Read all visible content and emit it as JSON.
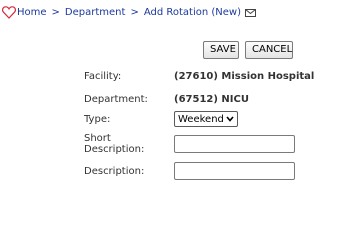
{
  "breadcrumb": {
    "items": [
      "Home",
      "Department",
      "Add Rotation (New)"
    ],
    "separator": ">"
  },
  "toolbar": {
    "save_label": "SAVE",
    "cancel_label": "CANCEL"
  },
  "form": {
    "facility": {
      "label": "Facility:",
      "value": "(27610) Mission Hospital"
    },
    "department": {
      "label": "Department:",
      "value": "(67512) NICU"
    },
    "type": {
      "label": "Type:",
      "selected": "Weekend"
    },
    "short_description": {
      "label": "Short Description:",
      "value": "",
      "placeholder": ""
    },
    "description": {
      "label": "Description:",
      "value": "",
      "placeholder": ""
    }
  },
  "icons": {
    "logo": "heart-icon",
    "email": "mail-icon",
    "dropdown": "chevron-down-icon"
  },
  "colors": {
    "link": "#1c3a9c",
    "heart": "#d9283a",
    "text": "#333333"
  }
}
